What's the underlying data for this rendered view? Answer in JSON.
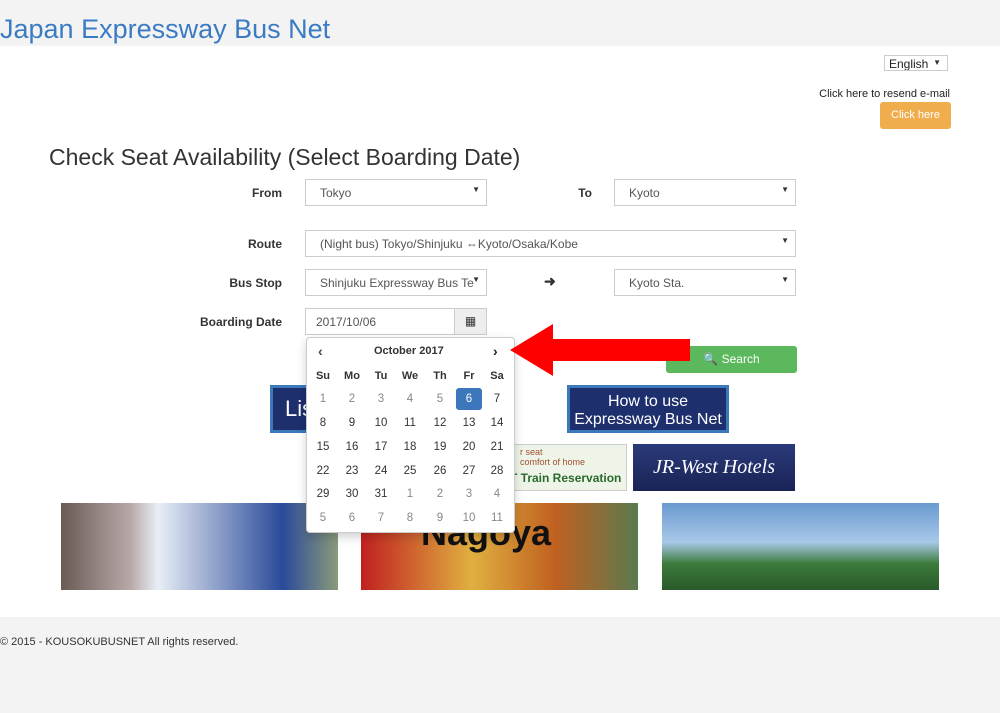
{
  "site_title": "Japan Expressway Bus Net",
  "language": "English",
  "resend_text": "Click here to resend e-mail",
  "resend_button": "Click here",
  "heading": "Check Seat Availability (Select Boarding Date)",
  "form": {
    "from_label": "From",
    "from_value": "Tokyo",
    "to_label": "To",
    "to_value": "Kyoto",
    "route_label": "Route",
    "route_value": "(Night bus) Tokyo/Shinjuku ⇔Kyoto/Osaka/Kobe",
    "busstop_label": "Bus Stop",
    "busstop_from": "Shinjuku Expressway Bus Te",
    "busstop_to": "Kyoto Sta.",
    "date_label": "Boarding Date",
    "date_value": "2017/10/06",
    "search_label": "Search"
  },
  "calendar": {
    "month": "October 2017",
    "weekdays": [
      "Su",
      "Mo",
      "Tu",
      "We",
      "Th",
      "Fr",
      "Sa"
    ],
    "weeks": [
      [
        "1",
        "2",
        "3",
        "4",
        "5",
        "6",
        "7"
      ],
      [
        "8",
        "9",
        "10",
        "11",
        "12",
        "13",
        "14"
      ],
      [
        "15",
        "16",
        "17",
        "18",
        "19",
        "20",
        "21"
      ],
      [
        "22",
        "23",
        "24",
        "25",
        "26",
        "27",
        "28"
      ],
      [
        "29",
        "30",
        "31",
        "1",
        "2",
        "3",
        "4"
      ],
      [
        "5",
        "6",
        "7",
        "8",
        "9",
        "10",
        "11"
      ]
    ],
    "selected": "6"
  },
  "banners": {
    "list": "Lis",
    "howto_line1": "How to use",
    "howto_line2": "Expressway Bus Net",
    "train_line1": "r seat",
    "train_line2": "comfort of home",
    "train_line3": "T Train Reservation",
    "hotels": "JR-West Hotels",
    "nagoya": "Nagoya"
  },
  "colors": {
    "accent": "#3b7bc4",
    "search": "#5cb85c",
    "resend": "#f0ad4e",
    "arrow": "#ff0000"
  },
  "footer": "© 2015 - KOUSOKUBUSNET All rights reserved."
}
